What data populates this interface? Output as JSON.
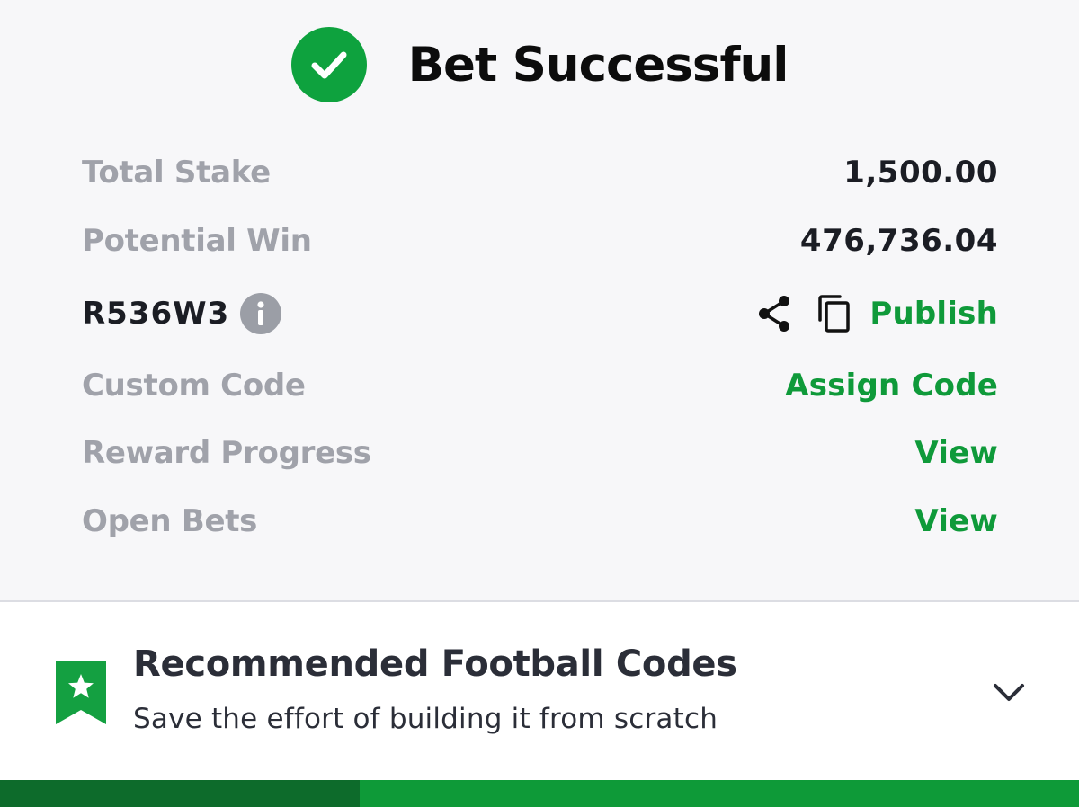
{
  "header": {
    "title": "Bet Successful",
    "icon": "check-circle-icon"
  },
  "summary": {
    "total_stake_label": "Total Stake",
    "total_stake_value": "1,500.00",
    "potential_win_label": "Potential Win",
    "potential_win_value": "476,736.04",
    "booking_code": "R536W3",
    "publish_label": "Publish",
    "custom_code_label": "Custom Code",
    "assign_code_label": "Assign Code",
    "reward_progress_label": "Reward Progress",
    "reward_view_label": "View",
    "open_bets_label": "Open Bets",
    "open_bets_view_label": "View"
  },
  "recommended": {
    "title": "Recommended Football Codes",
    "subtitle": "Save the effort of building it from scratch",
    "icon": "bookmark-star-icon"
  },
  "colors": {
    "accent": "#0f9a3a",
    "success": "#0ea23e",
    "label": "#a0a2aa",
    "text": "#1b1d24"
  }
}
